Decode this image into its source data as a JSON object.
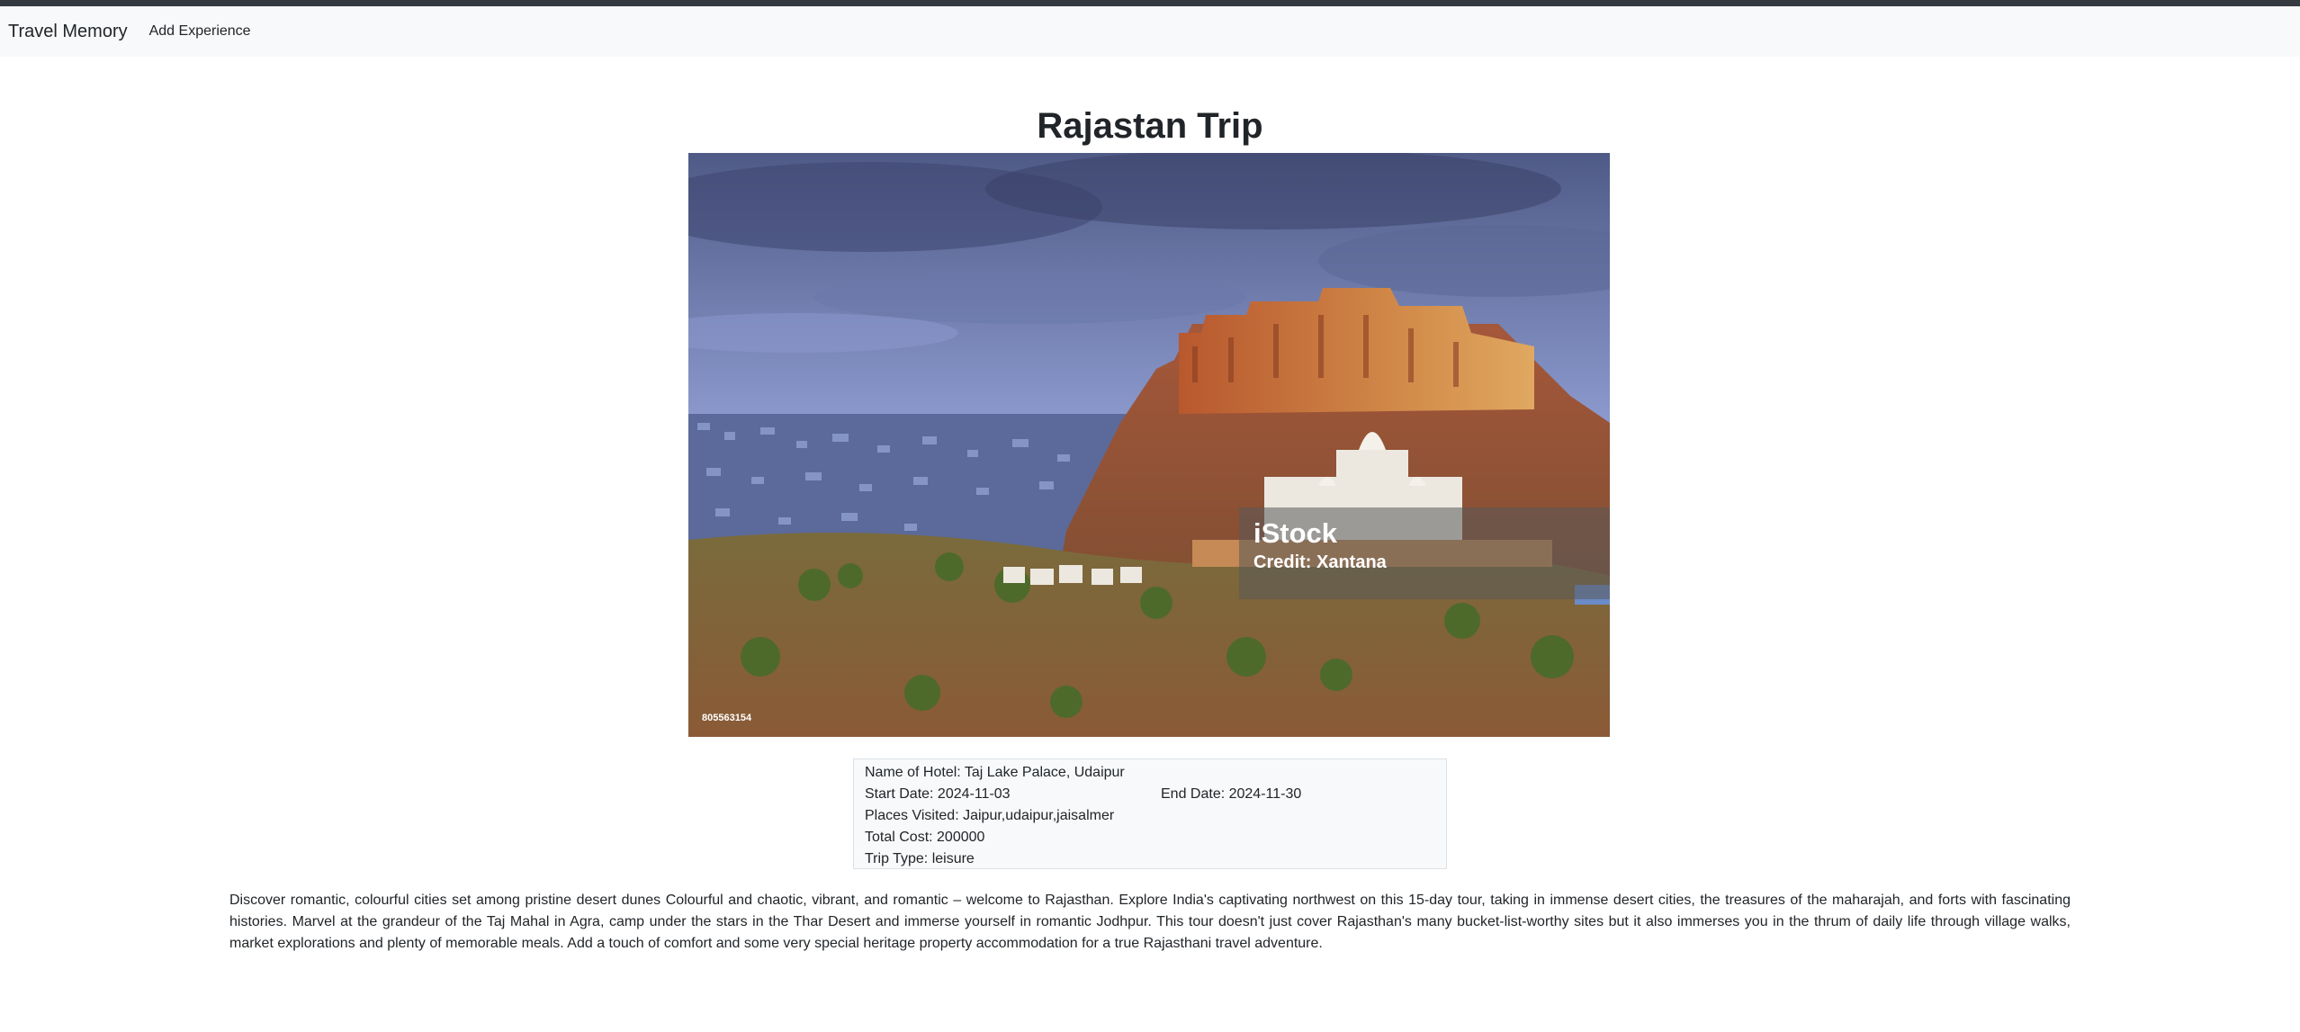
{
  "nav": {
    "brand": "Travel Memory",
    "add_experience": "Add Experience"
  },
  "page": {
    "title": "Rajastan Trip"
  },
  "image": {
    "alt": "Mehrangarh Fort and Jaswant Thada overlooking the blue city of Jodhpur",
    "watermark_brand": "iStock",
    "watermark_credit": "Credit: Xantana",
    "stock_id": "805563154"
  },
  "details": {
    "hotel": "Name of Hotel: Taj Lake Palace, Udaipur",
    "start_date": "Start Date: 2024-11-03",
    "end_date": "End Date: 2024-11-30",
    "places": "Places Visited: Jaipur,udaipur,jaisalmer",
    "cost": "Total Cost: 200000",
    "trip_type": "Trip Type: leisure"
  },
  "description": "Discover romantic, colourful cities set among pristine desert dunes Colourful and chaotic, vibrant, and romantic – welcome to Rajasthan. Explore India's captivating northwest on this 15-day tour, taking in immense desert cities, the treasures of the maharajah, and forts with fascinating histories. Marvel at the grandeur of the Taj Mahal in Agra, camp under the stars in the Thar Desert and immerse yourself in romantic Jodhpur. This tour doesn't just cover Rajasthan's many bucket-list-worthy sites but it also immerses you in the thrum of daily life through village walks, market explorations and plenty of memorable meals. Add a touch of comfort and some very special heritage property accommodation for a true Rajasthani travel adventure.",
  "colors": {
    "navbar_bg": "#f8f9fa",
    "top_strip": "#343a40",
    "text": "#212529"
  }
}
